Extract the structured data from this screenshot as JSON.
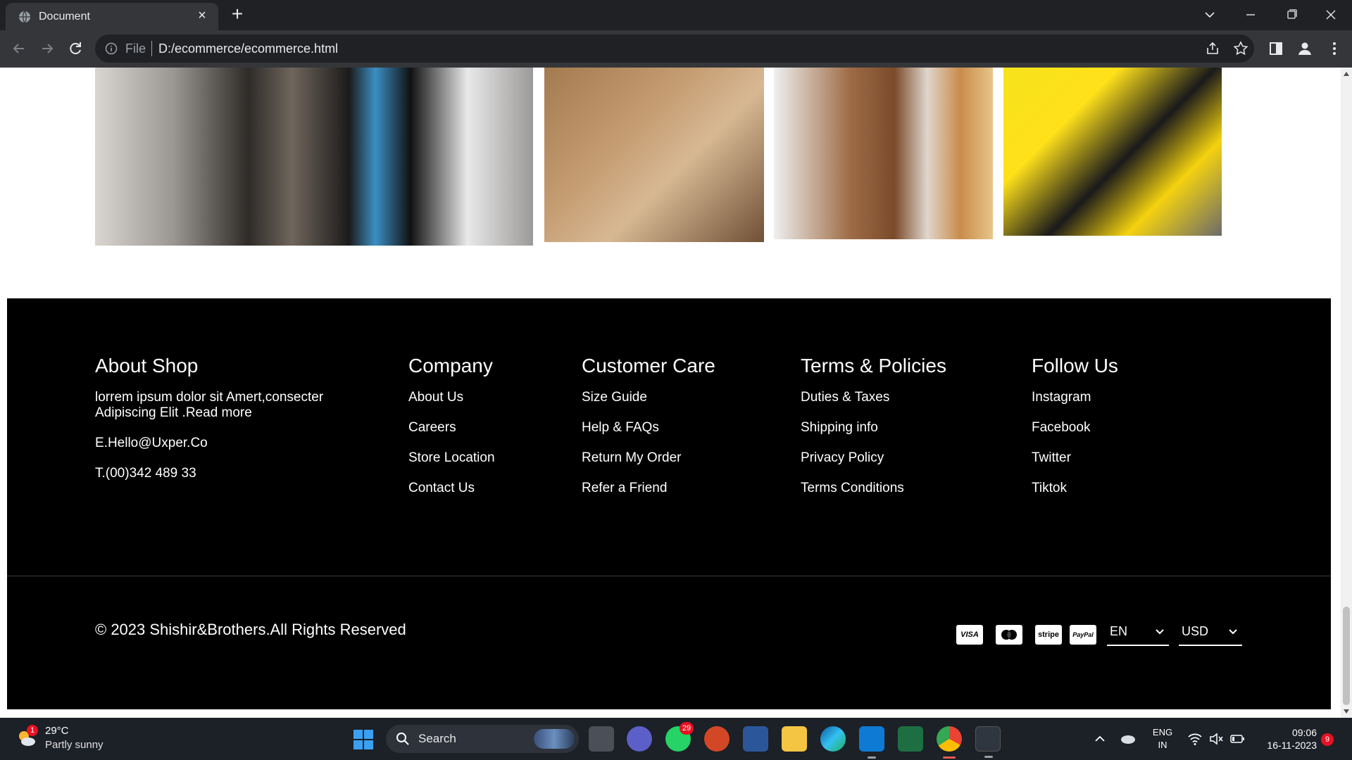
{
  "browser": {
    "tab_title": "Document",
    "url_scheme": "File",
    "url": "D:/ecommerce/ecommerce.html"
  },
  "footer": {
    "about": {
      "heading": "About Shop",
      "text": "lorrem ipsum dolor sit Amert,consecter Adipiscing Elit .Read more",
      "email": "E.Hello@Uxper.Co",
      "phone": "T.(00)342 489 33"
    },
    "company": {
      "heading": "Company",
      "links": [
        "About Us",
        "Careers",
        "Store Location",
        "Contact Us"
      ]
    },
    "customer_care": {
      "heading": "Customer Care",
      "links": [
        "Size Guide",
        "Help & FAQs",
        "Return My Order",
        "Refer a Friend"
      ]
    },
    "terms": {
      "heading": "Terms & Policies",
      "links": [
        "Duties & Taxes",
        "Shipping info",
        "Privacy Policy",
        "Terms Conditions"
      ]
    },
    "follow": {
      "heading": "Follow Us",
      "links": [
        "Instagram",
        "Facebook",
        "Twitter",
        "Tiktok"
      ]
    },
    "copyright": "© 2023 Shishir&Brothers.All Rights Reserved",
    "payments": [
      "VISA",
      "stripe",
      "PayPal"
    ],
    "language": "EN",
    "currency": "USD"
  },
  "taskbar": {
    "weather_temp": "29°C",
    "weather_cond": "Partly sunny",
    "weather_badge": "1",
    "search_label": "Search",
    "whatsapp_badge": "29",
    "lang_line1": "ENG",
    "lang_line2": "IN",
    "time": "09:06",
    "date": "16-11-2023",
    "notification_count": "9"
  }
}
